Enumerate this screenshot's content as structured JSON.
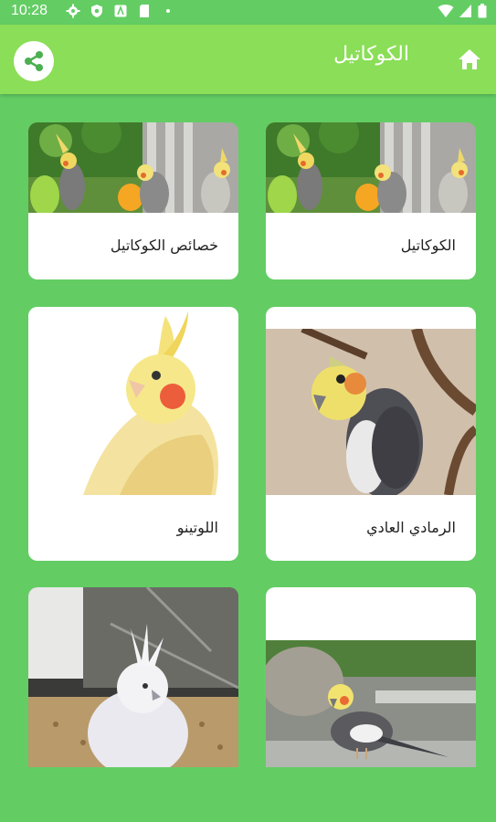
{
  "status_bar": {
    "time": "10:28",
    "left_icons": [
      "gear-icon",
      "shield-icon",
      "text-icon",
      "sd-card-icon",
      "dot-icon"
    ],
    "right_icons": [
      "wifi-icon",
      "signal-icon",
      "battery-icon"
    ]
  },
  "app_bar": {
    "title": "الكوكاتيل",
    "share_icon": "share-icon",
    "home_icon": "home-icon",
    "color": "#8bde57"
  },
  "background_color": "#63cd64",
  "cards": [
    {
      "label": "الكوكاتيل"
    },
    {
      "label": "خصائص الكوكاتيل"
    },
    {
      "label": "الرمادي العادي"
    },
    {
      "label": "اللوتينو"
    },
    {
      "label": ""
    },
    {
      "label": ""
    }
  ]
}
